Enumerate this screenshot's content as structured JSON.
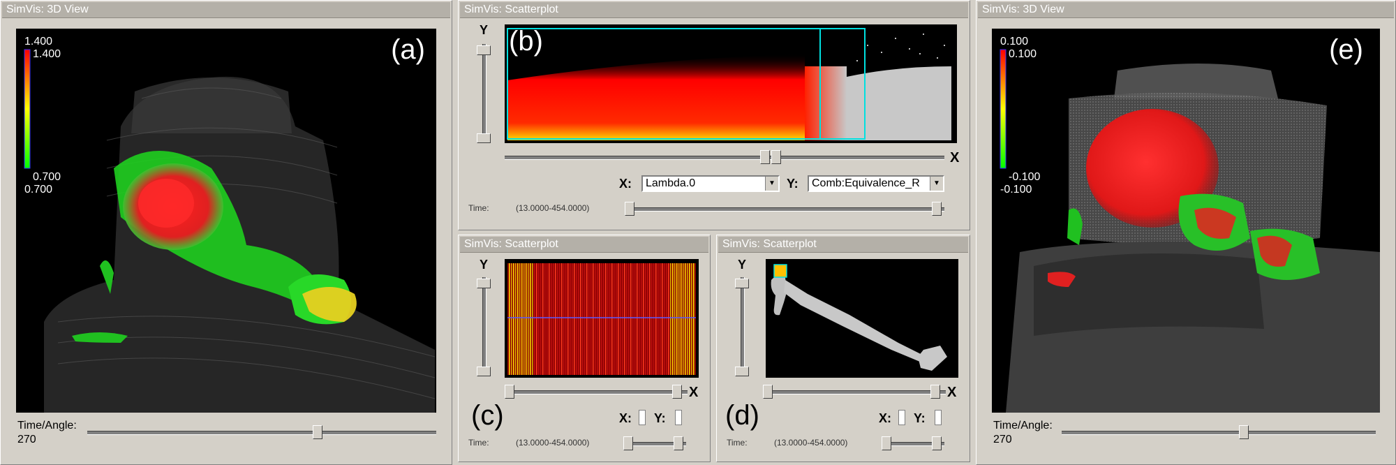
{
  "panel_a": {
    "title": "SimVis: 3D View",
    "figure_label": "(a)",
    "legend_top": "1.400",
    "legend_max": "1.400",
    "legend_min": "0.700",
    "legend_bottom": "0.700",
    "slider_label": "Time/Angle:",
    "slider_value": "270",
    "slider_fraction": 0.66
  },
  "panel_b": {
    "title": "SimVis: Scatterplot",
    "figure_label": "(b)",
    "y_label": "Y",
    "x_close": "X",
    "x_axis_label": "X:",
    "x_axis_value": "Lambda.0",
    "y_axis_label": "Y:",
    "y_axis_value": "Comb:Equivalence_R",
    "time_label": "Time:",
    "time_range": "(13.0000-454.0000)"
  },
  "panel_c": {
    "title": "SimVis: Scatterplot",
    "figure_label": "(c)",
    "y_label": "Y",
    "x_close": "X",
    "x_axis_label": "X:",
    "y_axis_label": "Y:",
    "time_label": "Time:",
    "time_range": "(13.0000-454.0000)"
  },
  "panel_d": {
    "title": "SimVis: Scatterplot",
    "figure_label": "(d)",
    "y_label": "Y",
    "x_close": "X",
    "x_axis_label": "X:",
    "y_axis_label": "Y:",
    "time_label": "Time:",
    "time_range": "(13.0000-454.0000)"
  },
  "panel_e": {
    "title": "SimVis: 3D View",
    "figure_label": "(e)",
    "legend_top": "0.100",
    "legend_max": "0.100",
    "legend_min": "-0.100",
    "legend_bottom": "-0.100",
    "slider_label": "Time/Angle:",
    "slider_value": "270",
    "slider_fraction": 0.58
  },
  "colors": {
    "window_bg": "#d4d0c8",
    "titlebar": "#b4b0a8",
    "focus_red": "#ff1a1a",
    "context_green": "#22dd22",
    "highlight_yellow": "#ffe000",
    "brush_cyan": "#00e0e0"
  }
}
